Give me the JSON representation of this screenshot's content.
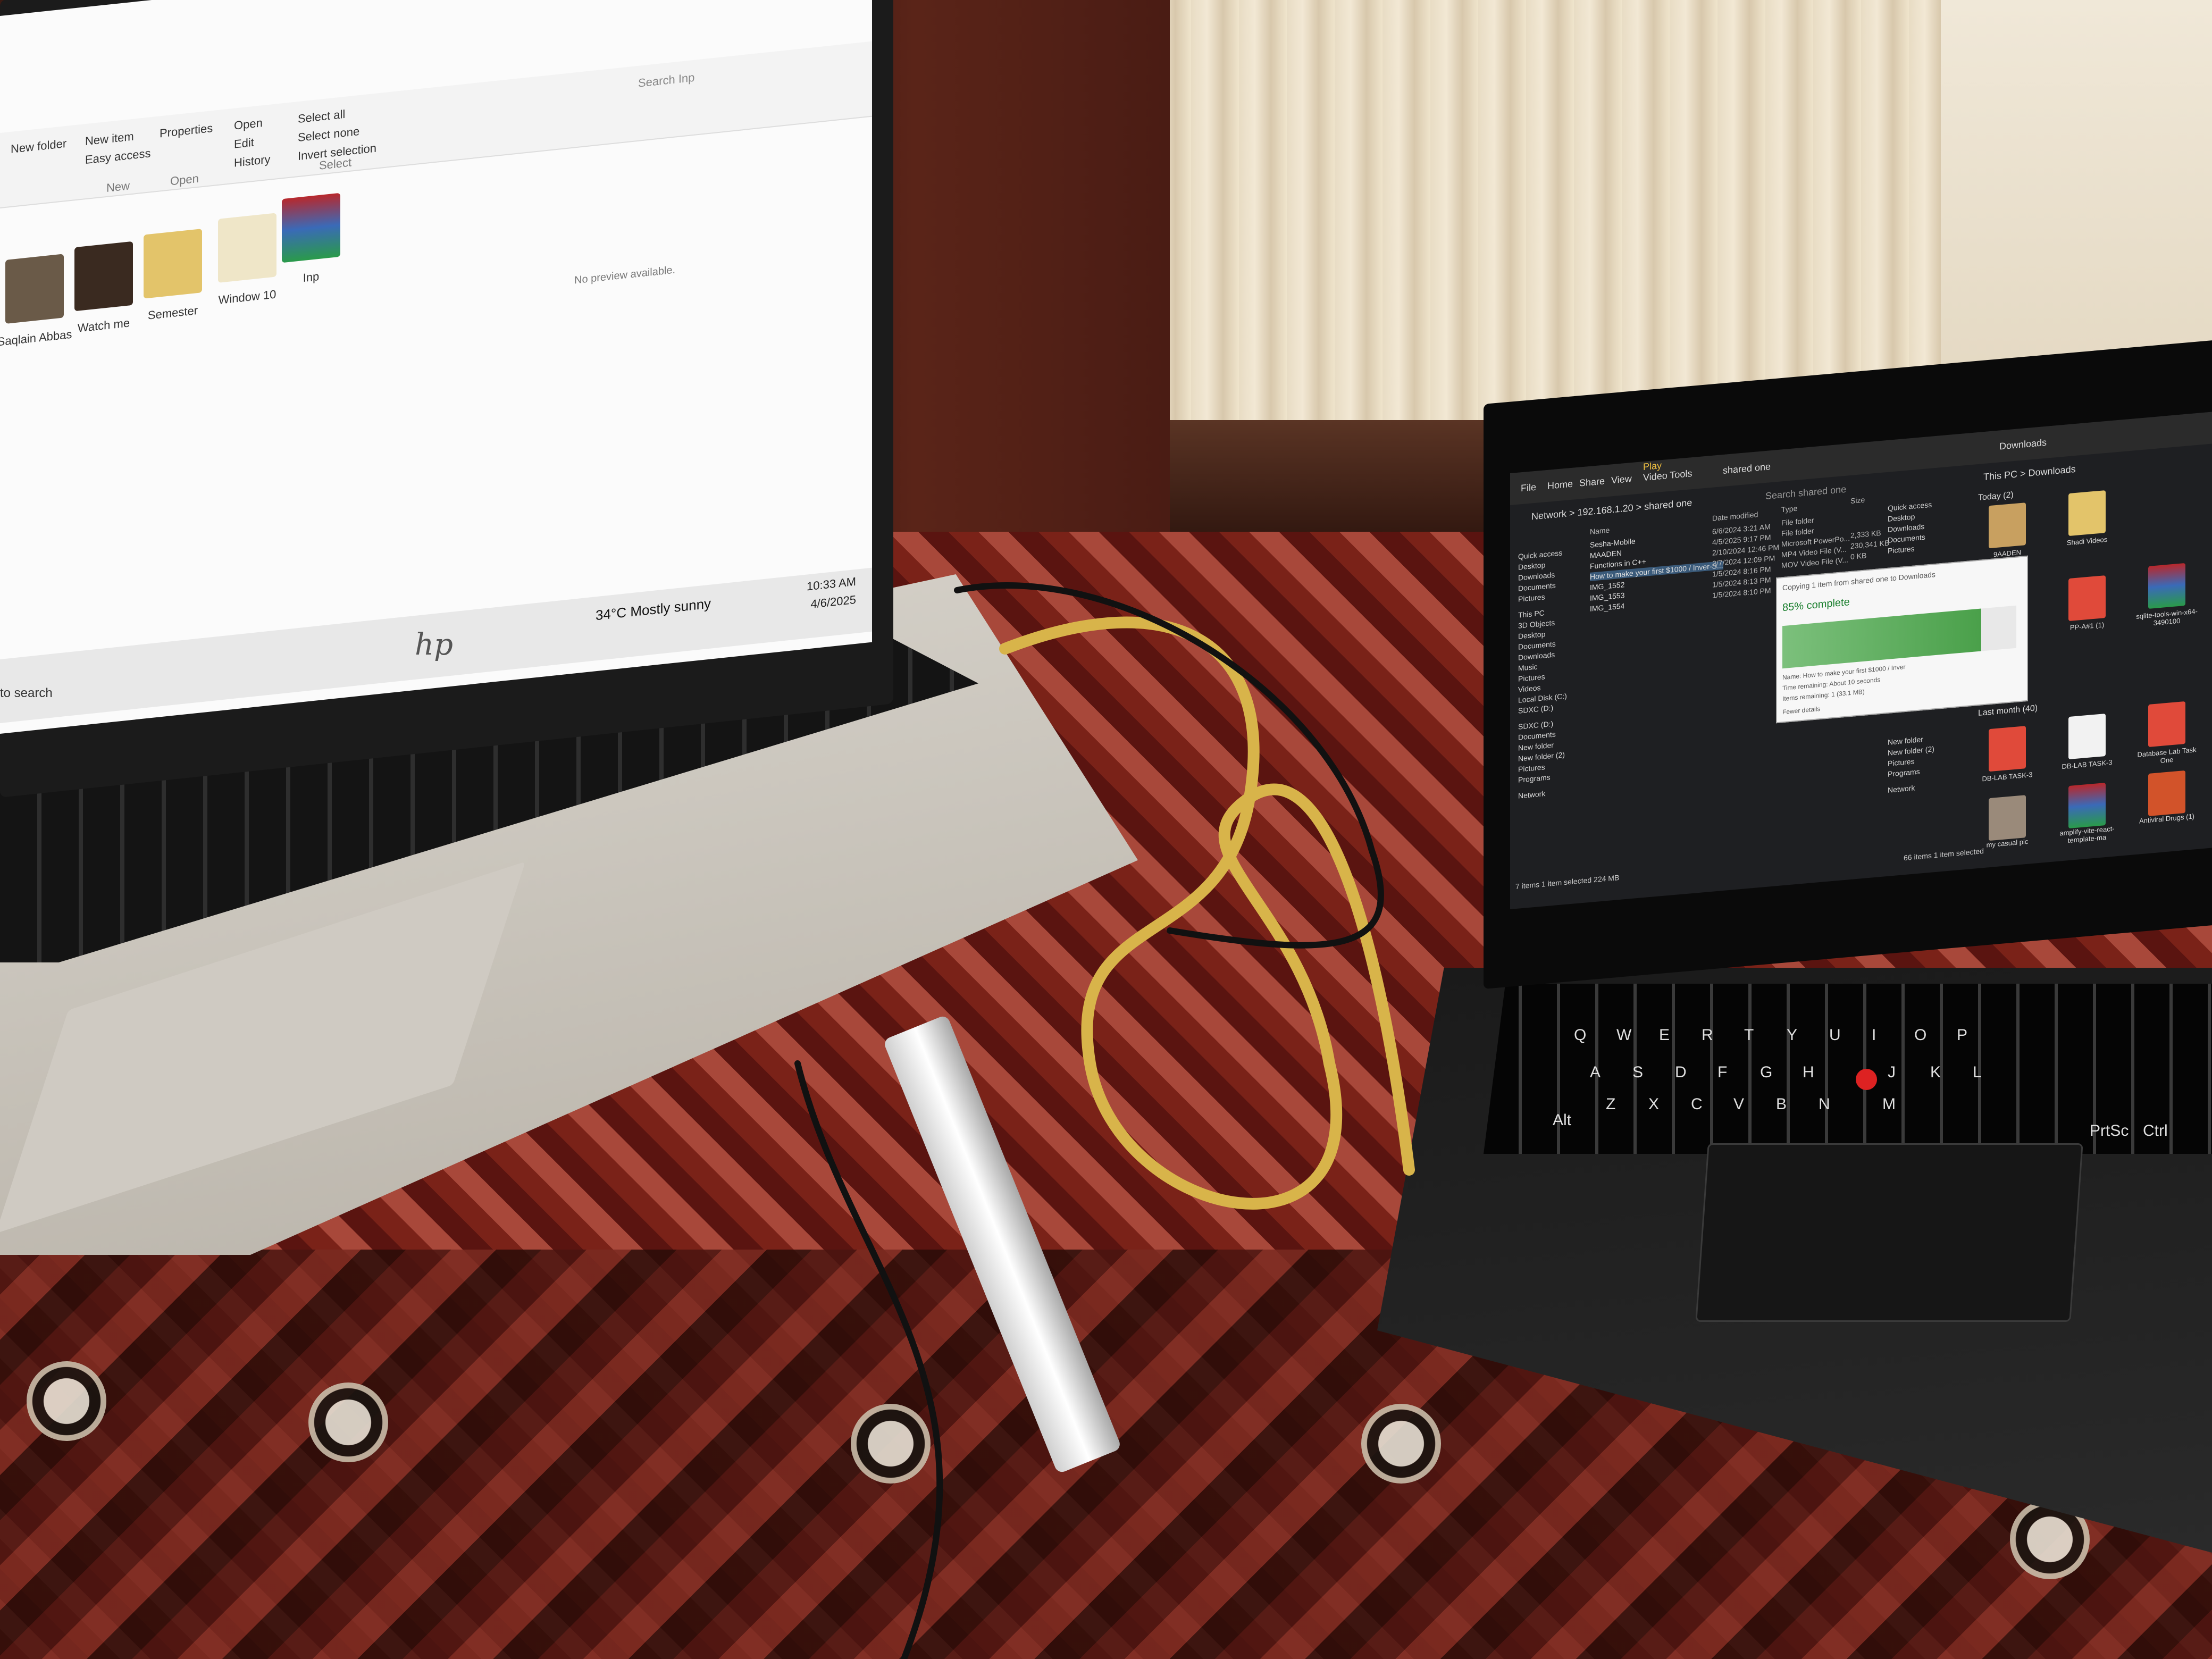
{
  "scene": {
    "description_labels": []
  },
  "left_laptop": {
    "brand_logo": "hp",
    "explorer": {
      "ribbon": {
        "groups": [
          "New",
          "Open",
          "Select"
        ],
        "items": [
          "New item",
          "Easy access",
          "Open",
          "Edit",
          "History",
          "Select all",
          "Select none",
          "Invert selection",
          "Properties",
          "New folder"
        ]
      },
      "folders": [
        {
          "label": "Saqlain Abbas",
          "icon": "photo-folder-icon",
          "color": "#6a5a48"
        },
        {
          "label": "Watch me",
          "icon": "photo-folder-icon",
          "color": "#3a2a20"
        },
        {
          "label": "Semester",
          "icon": "folder-icon",
          "color": "#e3c46a"
        },
        {
          "label": "Window 10",
          "icon": "folder-icon",
          "color": "#efe6c8"
        },
        {
          "label": "Inp",
          "icon": "winrar-icon",
          "color": "#b8282c"
        }
      ],
      "empty_text": "No preview available.",
      "search_placeholder": "Search Inp"
    },
    "taskbar": {
      "search_text": "to search",
      "weather": "34°C Mostly sunny",
      "time": "10:33 AM",
      "date": "4/6/2025"
    }
  },
  "right_laptop": {
    "explorer_left": {
      "tabs": [
        "File",
        "Home",
        "Share",
        "View",
        "Video Tools"
      ],
      "active_tab_label": "Play",
      "window_title": "shared one",
      "path": "Network > 192.168.1.20 > shared one",
      "search_placeholder": "Search shared one",
      "columns": [
        "Name",
        "Date modified",
        "Type",
        "Size"
      ],
      "nav": [
        "Quick access",
        "Desktop",
        "Downloads",
        "Documents",
        "Pictures",
        "This PC",
        "3D Objects",
        "Desktop",
        "Documents",
        "Downloads",
        "Music",
        "Pictures",
        "Videos",
        "Local Disk (C:)",
        "SDXC (D:)",
        "SDXC (D:)",
        "Documents",
        "New folder",
        "New folder (2)",
        "Pictures",
        "Programs",
        "Network"
      ],
      "files": [
        {
          "name": "Sesha-Mobile",
          "date": "6/6/2024 3:21 AM",
          "type": "File folder",
          "size": ""
        },
        {
          "name": "MAADEN",
          "date": "4/5/2025 9:17 PM",
          "type": "File folder",
          "size": ""
        },
        {
          "name": "Functions in C++",
          "date": "2/10/2024 12:46 PM",
          "type": "Microsoft PowerPo...",
          "size": "2,333 KB"
        },
        {
          "name": "How to make your first $1000 / Inver-S...",
          "date": "2/7/2024 12:09 PM",
          "type": "MP4 Video File (V...",
          "size": "230,341 KB"
        },
        {
          "name": "IMG_1552",
          "date": "1/5/2024 8:16 PM",
          "type": "MOV Video File (V...",
          "size": "0 KB"
        },
        {
          "name": "IMG_1553",
          "date": "1/5/2024 8:13 PM",
          "type": "",
          "size": ""
        },
        {
          "name": "IMG_1554",
          "date": "1/5/2024 8:10 PM",
          "type": "",
          "size": ""
        }
      ],
      "status": "7 items   1 item selected  224 MB"
    },
    "copy_dialog": {
      "title": "Copying 1 item from shared one to Downloads",
      "percent": "85% complete",
      "lines": [
        "Name: How to make your first $1000 / Inver",
        "Time remaining: About 10 seconds",
        "Items remaining: 1 (33.1 MB)"
      ],
      "fewer_details": "Fewer details",
      "progress_fraction": 0.85
    },
    "explorer_right": {
      "tabs": [
        "File",
        "Home",
        "Share",
        "View",
        "Video Tools"
      ],
      "title": "Downloads",
      "path": "This PC > Downloads",
      "groups": [
        "Today (2)",
        "Last month (40)"
      ],
      "nav": [
        "Quick access",
        "Desktop",
        "Downloads",
        "Documents",
        "Pictures",
        "New folder",
        "New folder (2)",
        "Pictures",
        "Programs",
        "Network"
      ],
      "tiles": [
        {
          "label": "9AADEN",
          "icon": "photo-icon",
          "color": "#c8a060"
        },
        {
          "label": "Shadi Videos",
          "icon": "folder-icon",
          "color": "#e3c46a"
        },
        {
          "label": "PP-A#1 (1)",
          "icon": "pdf-icon",
          "color": "#e04a3a"
        },
        {
          "label": "sqlite-tools-win-x64-3490100",
          "icon": "winrar-icon",
          "color": "#b8282c"
        },
        {
          "label": "DB-LAB TASK-3",
          "icon": "pdf-icon",
          "color": "#e04a3a"
        },
        {
          "label": "DB-LAB TASK-3",
          "icon": "file-icon",
          "color": "#f2f2f2"
        },
        {
          "label": "Database Lab Task One",
          "icon": "pdf-icon",
          "color": "#e04a3a"
        },
        {
          "label": "my casual pic",
          "icon": "photo-icon",
          "color": "#9a8a7a"
        },
        {
          "label": "amplify-vite-react-template-ma",
          "icon": "winrar-icon",
          "color": "#b8282c"
        },
        {
          "label": "Antiviral Drugs (1)",
          "icon": "ppt-icon",
          "color": "#d2532a"
        }
      ],
      "status": "66 items   1 item selected"
    },
    "keyboard_labels": [
      "Q",
      "W",
      "E",
      "R",
      "T",
      "Y",
      "U",
      "I",
      "O",
      "P",
      "A",
      "S",
      "D",
      "F",
      "G",
      "H",
      "J",
      "K",
      "L",
      "Z",
      "X",
      "C",
      "V",
      "B",
      "N",
      "M",
      "Alt",
      "PrtSc",
      "Ctrl"
    ]
  },
  "colors": {
    "cable_yellow": "#d8b44a",
    "cable_black": "#111111",
    "quilt_red": "#7a2218",
    "screen_dark": "#1e1f22"
  }
}
